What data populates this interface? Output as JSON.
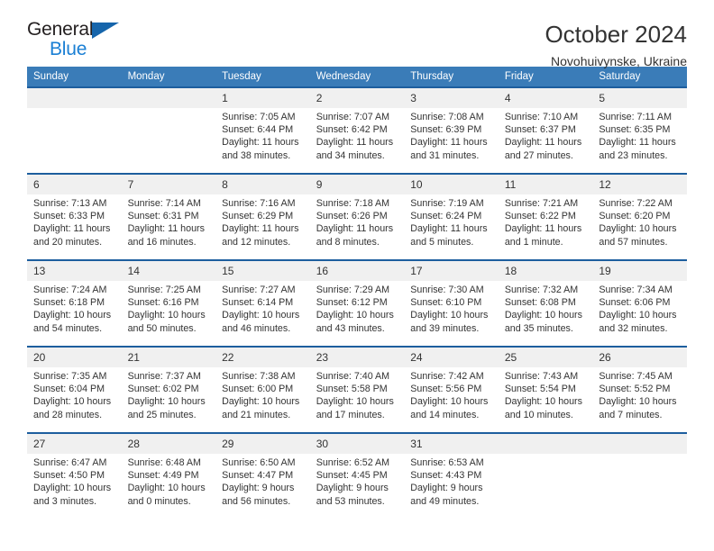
{
  "logo": {
    "word_top": "General",
    "word_bottom": "Blue",
    "triangle_icon": "triangle-icon",
    "color_dark": "#231f20",
    "color_blue": "#1a7fd4"
  },
  "header": {
    "title": "October 2024",
    "subtitle": "Novohuivynske, Ukraine"
  },
  "theme": {
    "header_bg": "#3a7cb8",
    "week_separator": "#1d5e9e",
    "daynum_bg": "#f0f0f0",
    "text": "#333333"
  },
  "calendar": {
    "weekday_headers": [
      "Sunday",
      "Monday",
      "Tuesday",
      "Wednesday",
      "Thursday",
      "Friday",
      "Saturday"
    ],
    "weeks": [
      [
        {
          "day": "",
          "lines": []
        },
        {
          "day": "",
          "lines": []
        },
        {
          "day": "1",
          "lines": [
            "Sunrise: 7:05 AM",
            "Sunset: 6:44 PM",
            "Daylight: 11 hours",
            "and 38 minutes."
          ]
        },
        {
          "day": "2",
          "lines": [
            "Sunrise: 7:07 AM",
            "Sunset: 6:42 PM",
            "Daylight: 11 hours",
            "and 34 minutes."
          ]
        },
        {
          "day": "3",
          "lines": [
            "Sunrise: 7:08 AM",
            "Sunset: 6:39 PM",
            "Daylight: 11 hours",
            "and 31 minutes."
          ]
        },
        {
          "day": "4",
          "lines": [
            "Sunrise: 7:10 AM",
            "Sunset: 6:37 PM",
            "Daylight: 11 hours",
            "and 27 minutes."
          ]
        },
        {
          "day": "5",
          "lines": [
            "Sunrise: 7:11 AM",
            "Sunset: 6:35 PM",
            "Daylight: 11 hours",
            "and 23 minutes."
          ]
        }
      ],
      [
        {
          "day": "6",
          "lines": [
            "Sunrise: 7:13 AM",
            "Sunset: 6:33 PM",
            "Daylight: 11 hours",
            "and 20 minutes."
          ]
        },
        {
          "day": "7",
          "lines": [
            "Sunrise: 7:14 AM",
            "Sunset: 6:31 PM",
            "Daylight: 11 hours",
            "and 16 minutes."
          ]
        },
        {
          "day": "8",
          "lines": [
            "Sunrise: 7:16 AM",
            "Sunset: 6:29 PM",
            "Daylight: 11 hours",
            "and 12 minutes."
          ]
        },
        {
          "day": "9",
          "lines": [
            "Sunrise: 7:18 AM",
            "Sunset: 6:26 PM",
            "Daylight: 11 hours",
            "and 8 minutes."
          ]
        },
        {
          "day": "10",
          "lines": [
            "Sunrise: 7:19 AM",
            "Sunset: 6:24 PM",
            "Daylight: 11 hours",
            "and 5 minutes."
          ]
        },
        {
          "day": "11",
          "lines": [
            "Sunrise: 7:21 AM",
            "Sunset: 6:22 PM",
            "Daylight: 11 hours",
            "and 1 minute."
          ]
        },
        {
          "day": "12",
          "lines": [
            "Sunrise: 7:22 AM",
            "Sunset: 6:20 PM",
            "Daylight: 10 hours",
            "and 57 minutes."
          ]
        }
      ],
      [
        {
          "day": "13",
          "lines": [
            "Sunrise: 7:24 AM",
            "Sunset: 6:18 PM",
            "Daylight: 10 hours",
            "and 54 minutes."
          ]
        },
        {
          "day": "14",
          "lines": [
            "Sunrise: 7:25 AM",
            "Sunset: 6:16 PM",
            "Daylight: 10 hours",
            "and 50 minutes."
          ]
        },
        {
          "day": "15",
          "lines": [
            "Sunrise: 7:27 AM",
            "Sunset: 6:14 PM",
            "Daylight: 10 hours",
            "and 46 minutes."
          ]
        },
        {
          "day": "16",
          "lines": [
            "Sunrise: 7:29 AM",
            "Sunset: 6:12 PM",
            "Daylight: 10 hours",
            "and 43 minutes."
          ]
        },
        {
          "day": "17",
          "lines": [
            "Sunrise: 7:30 AM",
            "Sunset: 6:10 PM",
            "Daylight: 10 hours",
            "and 39 minutes."
          ]
        },
        {
          "day": "18",
          "lines": [
            "Sunrise: 7:32 AM",
            "Sunset: 6:08 PM",
            "Daylight: 10 hours",
            "and 35 minutes."
          ]
        },
        {
          "day": "19",
          "lines": [
            "Sunrise: 7:34 AM",
            "Sunset: 6:06 PM",
            "Daylight: 10 hours",
            "and 32 minutes."
          ]
        }
      ],
      [
        {
          "day": "20",
          "lines": [
            "Sunrise: 7:35 AM",
            "Sunset: 6:04 PM",
            "Daylight: 10 hours",
            "and 28 minutes."
          ]
        },
        {
          "day": "21",
          "lines": [
            "Sunrise: 7:37 AM",
            "Sunset: 6:02 PM",
            "Daylight: 10 hours",
            "and 25 minutes."
          ]
        },
        {
          "day": "22",
          "lines": [
            "Sunrise: 7:38 AM",
            "Sunset: 6:00 PM",
            "Daylight: 10 hours",
            "and 21 minutes."
          ]
        },
        {
          "day": "23",
          "lines": [
            "Sunrise: 7:40 AM",
            "Sunset: 5:58 PM",
            "Daylight: 10 hours",
            "and 17 minutes."
          ]
        },
        {
          "day": "24",
          "lines": [
            "Sunrise: 7:42 AM",
            "Sunset: 5:56 PM",
            "Daylight: 10 hours",
            "and 14 minutes."
          ]
        },
        {
          "day": "25",
          "lines": [
            "Sunrise: 7:43 AM",
            "Sunset: 5:54 PM",
            "Daylight: 10 hours",
            "and 10 minutes."
          ]
        },
        {
          "day": "26",
          "lines": [
            "Sunrise: 7:45 AM",
            "Sunset: 5:52 PM",
            "Daylight: 10 hours",
            "and 7 minutes."
          ]
        }
      ],
      [
        {
          "day": "27",
          "lines": [
            "Sunrise: 6:47 AM",
            "Sunset: 4:50 PM",
            "Daylight: 10 hours",
            "and 3 minutes."
          ]
        },
        {
          "day": "28",
          "lines": [
            "Sunrise: 6:48 AM",
            "Sunset: 4:49 PM",
            "Daylight: 10 hours",
            "and 0 minutes."
          ]
        },
        {
          "day": "29",
          "lines": [
            "Sunrise: 6:50 AM",
            "Sunset: 4:47 PM",
            "Daylight: 9 hours",
            "and 56 minutes."
          ]
        },
        {
          "day": "30",
          "lines": [
            "Sunrise: 6:52 AM",
            "Sunset: 4:45 PM",
            "Daylight: 9 hours",
            "and 53 minutes."
          ]
        },
        {
          "day": "31",
          "lines": [
            "Sunrise: 6:53 AM",
            "Sunset: 4:43 PM",
            "Daylight: 9 hours",
            "and 49 minutes."
          ]
        },
        {
          "day": "",
          "lines": []
        },
        {
          "day": "",
          "lines": []
        }
      ]
    ]
  }
}
